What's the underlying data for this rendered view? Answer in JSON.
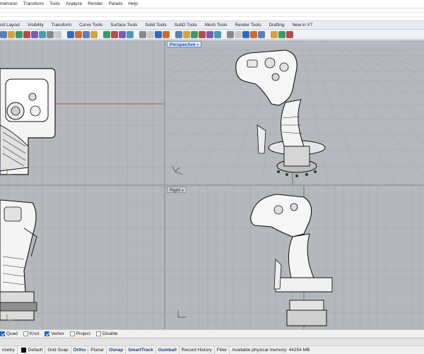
{
  "menu": [
    "mension",
    "Transform",
    "Tools",
    "Analyze",
    "Render",
    "Panels",
    "Help"
  ],
  "tabs": [
    "ort Layout",
    "Visibility",
    "Transform",
    "Curve Tools",
    "Surface Tools",
    "Solid Tools",
    "SubD Tools",
    "Mesh Tools",
    "Render Tools",
    "Drafting",
    "New in V7"
  ],
  "viewports": {
    "top_left": {
      "label": ""
    },
    "perspective": {
      "label": "Perspective"
    },
    "front": {
      "label": ""
    },
    "right": {
      "label": "Right"
    }
  },
  "axis_labels": {
    "x": "x",
    "y": "y",
    "z": "z"
  },
  "osnaps": [
    {
      "label": "Quad",
      "checked": true
    },
    {
      "label": "Knot",
      "checked": false
    },
    {
      "label": "Vertex",
      "checked": true
    },
    {
      "label": "Project",
      "checked": false
    },
    {
      "label": "Disable",
      "checked": false
    }
  ],
  "status": {
    "units": "imetry",
    "layer": "Default",
    "grid_snap": "Grid Snap",
    "ortho": "Ortho",
    "planar": "Planar",
    "osnap": "Osnap",
    "smarttrack": "SmartTrack",
    "gumball": "Gumball",
    "record_history": "Record History",
    "filter": "Filter",
    "memory": "Available physical memory: 44254 MB"
  },
  "colors": {
    "viewport_bg": "#b5b8bc",
    "grid_line": "#a7aaae",
    "x_axis": "#c0392b",
    "y_axis": "#2e8b2e",
    "active_label": "#1b57b7"
  },
  "icons": [
    "viewport-maximize-arrow-icon",
    "axis-triad-icon",
    "checkbox-icon"
  ]
}
